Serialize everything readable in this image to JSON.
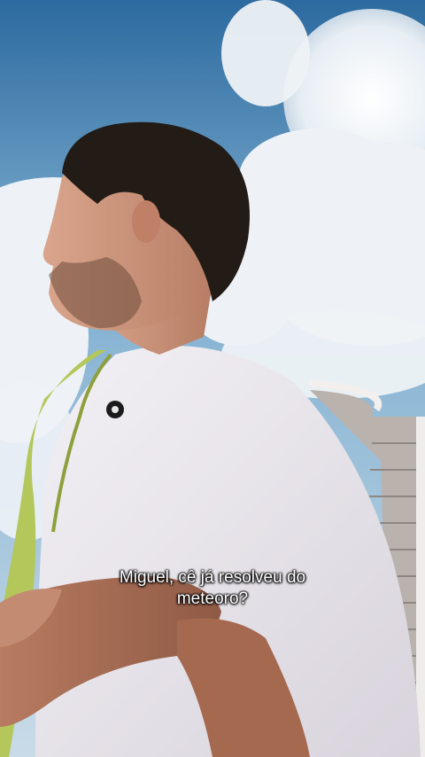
{
  "video": {
    "caption_lines": [
      "Miguel, cê já resolveu do",
      "meteoro?"
    ]
  },
  "colors": {
    "sky_top": "#2f6da0",
    "sky_bottom": "#a9c8df",
    "clouds": "#eef2f6",
    "shirt": "#e9e6ec",
    "scarf": "#b3c75a",
    "hair": "#231b16",
    "skin": "#c79178"
  }
}
